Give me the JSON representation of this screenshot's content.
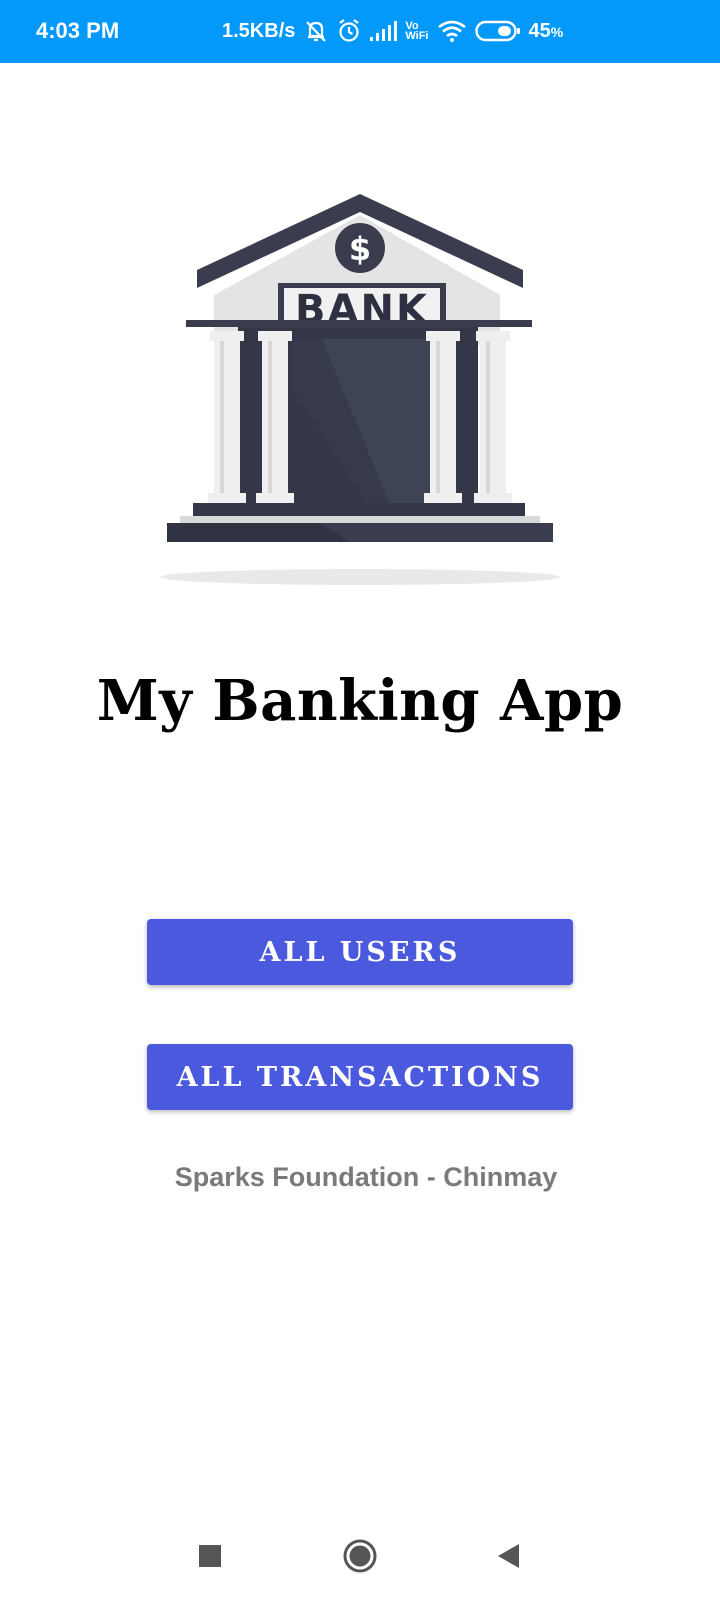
{
  "status_bar": {
    "time": "4:03 PM",
    "network_speed": "1.5KB/s",
    "vowifi_top": "Vo",
    "vowifi_bottom": "WiFi",
    "battery_percent": "45",
    "battery_unit": "%",
    "icons": [
      "notifications-muted-icon",
      "alarm-icon",
      "signal-icon",
      "vowifi-icon",
      "wifi-icon",
      "battery-icon"
    ]
  },
  "illustration": {
    "sign_text": "BANK",
    "currency_symbol": "$",
    "colors": {
      "roof": "#393d4e",
      "wall": "#e4e4e4",
      "door": "#333748",
      "columns": "#efefef",
      "base": "#2f3342"
    }
  },
  "app": {
    "title": "My Banking App",
    "buttons": {
      "all_users": "ALL USERS",
      "all_transactions": "ALL TRANSACTIONS"
    },
    "credit": "Sparks Foundation - Chinmay",
    "accent_color": "#4a59dd",
    "status_bar_color": "#0399fb"
  },
  "nav": {
    "icons": [
      "recent-apps-icon",
      "home-icon",
      "back-icon"
    ]
  }
}
